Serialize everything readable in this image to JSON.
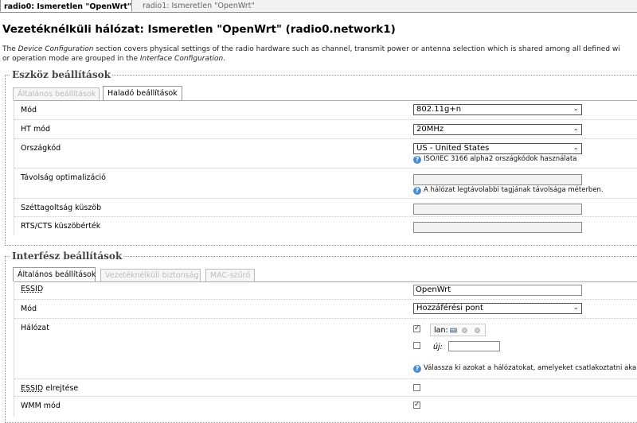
{
  "top_tabs": {
    "active": "radio0: Ismeretlen \"OpenWrt\"",
    "inactive": "radio1: Ismeretlen \"OpenWrt\""
  },
  "page_title": "Vezetéknélküli hálózat: Ismeretlen \"OpenWrt\" (radio0.network1)",
  "description": {
    "part1": "The ",
    "em1": "Device Configuration",
    "part2": " section covers physical settings of the radio hardware such as channel, transmit power or antenna selection which is shared among all defined wi",
    "part3": "or operation mode are grouped in the ",
    "em2": "Interface Configuration",
    "part4": "."
  },
  "device": {
    "legend": "Eszköz beállítások",
    "tabs": [
      "Általános beállítások",
      "Haladó beállítások"
    ],
    "rows": {
      "mode": {
        "label": "Mód",
        "value": "802.11g+n"
      },
      "htmode": {
        "label": "HT mód",
        "value": "20MHz"
      },
      "country": {
        "label": "Országkód",
        "value": "US - United States",
        "hint": "ISO/IEC 3166 alpha2 országkódok használata"
      },
      "distance": {
        "label": "Távolság optimalizáció",
        "value": "",
        "hint": "A hálózat legtávolabbi tagjának távolsága méterben."
      },
      "frag": {
        "label": "Széttagoltság küszöb",
        "value": ""
      },
      "rts": {
        "label": "RTS/CTS küszöbérték",
        "value": ""
      }
    }
  },
  "iface": {
    "legend": "Interfész beállítások",
    "tabs": [
      "Általános beállítások",
      "Vezetéknélküli biztonság",
      "MAC-szűrő"
    ],
    "rows": {
      "essid": {
        "label": "ESSID",
        "value": "OpenWrt"
      },
      "mode": {
        "label": "Mód",
        "value": "Hozzáférési pont"
      },
      "network": {
        "label": "Hálózat",
        "lan_label": "lan:",
        "lan_checked": true,
        "new_label": "új:",
        "new_checked": false,
        "new_value": "",
        "hint": "Válassza ki azokat a hálózatokat, amelyeket csatlakoztatni akar e"
      },
      "hide_essid": {
        "label_abbr": "ESSID",
        "label_rest": " elrejtése",
        "checked": false
      },
      "wmm": {
        "label": "WMM mód",
        "checked": true
      }
    }
  },
  "colors": {
    "hint_icon": "#4a8bd6"
  }
}
